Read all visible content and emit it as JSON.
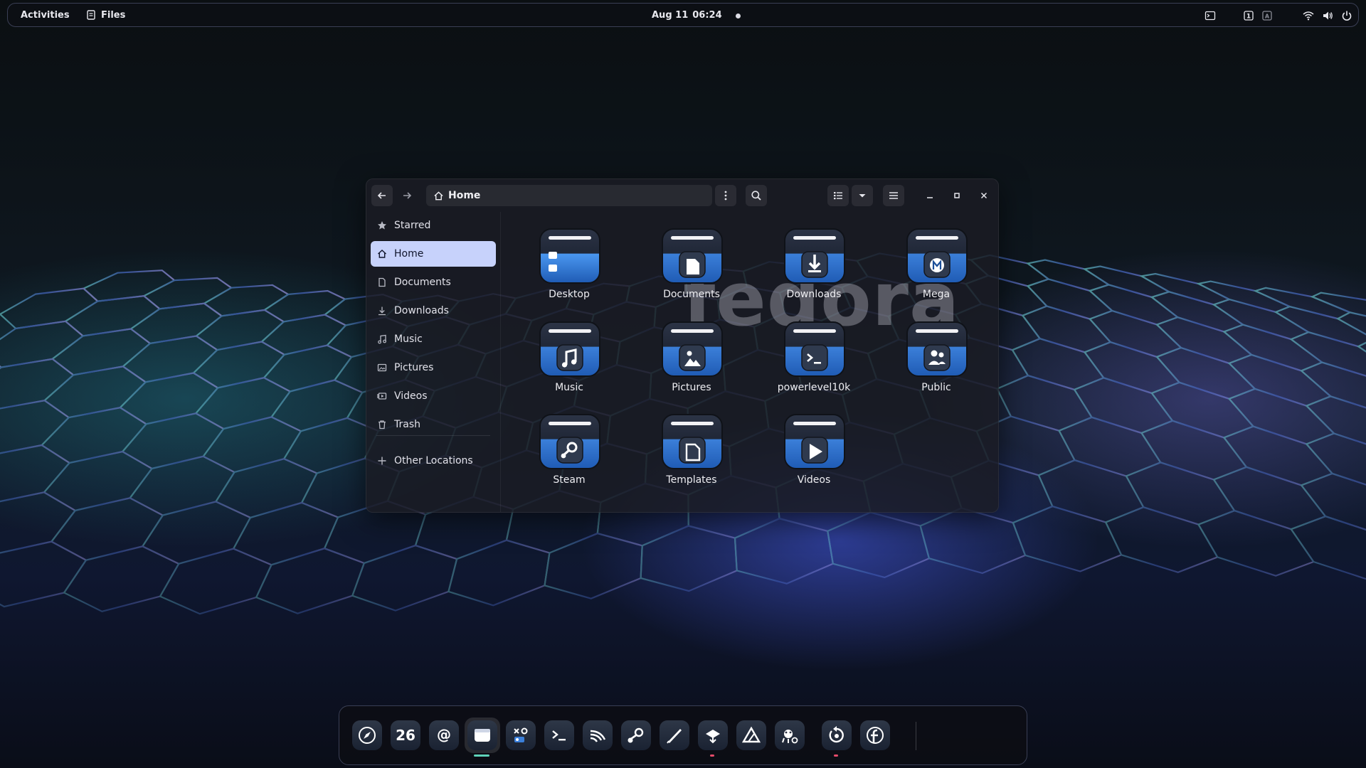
{
  "topbar": {
    "activities": "Activities",
    "app_name": "Files",
    "date": "Aug 11",
    "time": "06:24",
    "tray_icons": [
      "terminal-indicator-icon",
      "keyboard-layout-icon",
      "input-method-icon",
      "wifi-icon",
      "volume-icon",
      "power-icon"
    ]
  },
  "window": {
    "location": "Home",
    "header_icons": [
      "back-arrow-icon",
      "forward-arrow-icon",
      "home-icon",
      "kebab-menu-icon",
      "search-icon",
      "list-view-icon",
      "chevron-down-icon",
      "hamburger-menu-icon",
      "minimize-icon",
      "maximize-icon",
      "close-icon"
    ],
    "sidebar": [
      {
        "label": "Starred",
        "icon": "star-icon"
      },
      {
        "label": "Home",
        "icon": "home-icon",
        "active": true
      },
      {
        "label": "Documents",
        "icon": "document-icon"
      },
      {
        "label": "Downloads",
        "icon": "download-icon"
      },
      {
        "label": "Music",
        "icon": "music-icon"
      },
      {
        "label": "Pictures",
        "icon": "picture-icon"
      },
      {
        "label": "Videos",
        "icon": "video-icon"
      },
      {
        "label": "Trash",
        "icon": "trash-icon"
      },
      {
        "label": "Other Locations",
        "icon": "plus-icon"
      }
    ],
    "folders": [
      {
        "label": "Desktop",
        "emblem": "desktop"
      },
      {
        "label": "Documents",
        "emblem": "document"
      },
      {
        "label": "Downloads",
        "emblem": "download"
      },
      {
        "label": "Mega",
        "emblem": "mega"
      },
      {
        "label": "Music",
        "emblem": "music"
      },
      {
        "label": "Pictures",
        "emblem": "picture"
      },
      {
        "label": "powerlevel10k",
        "emblem": "terminal"
      },
      {
        "label": "Public",
        "emblem": "people"
      },
      {
        "label": "Steam",
        "emblem": "steam"
      },
      {
        "label": "Templates",
        "emblem": "template"
      },
      {
        "label": "Videos",
        "emblem": "video"
      }
    ],
    "wallpaper_watermark": "fedora"
  },
  "dock": {
    "apps": [
      {
        "name": "web-browser-icon"
      },
      {
        "name": "calendar-icon",
        "text": "26"
      },
      {
        "name": "mail-icon"
      },
      {
        "name": "files-icon",
        "active": true
      },
      {
        "name": "settings-tweaks-icon"
      },
      {
        "name": "terminal-icon"
      },
      {
        "name": "rss-icon"
      },
      {
        "name": "steam-icon"
      },
      {
        "name": "text-editor-icon"
      },
      {
        "name": "package-installer-icon",
        "running": true
      },
      {
        "name": "affinity-icon"
      },
      {
        "name": "gimp-icon"
      },
      {
        "name": "backup-icon",
        "running": true
      },
      {
        "name": "fedora-icon"
      }
    ]
  },
  "colors": {
    "accent": "#c7d2fb",
    "folder_top": "#3b7fd9",
    "running_dot": "#e64c6a",
    "active_indicator": "#5fd3b8"
  }
}
